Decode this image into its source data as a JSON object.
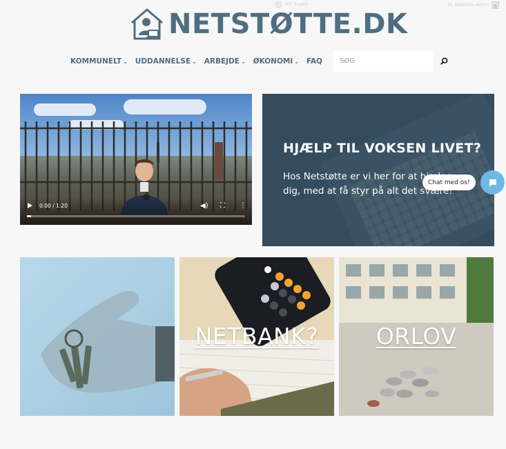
{
  "topbar": {
    "toggle_label": "HST   Englsh",
    "user_label": "Hi, Netstotte Admin"
  },
  "logo": {
    "text": "NETSTØTTE.DK",
    "icon": "house-person-icon"
  },
  "nav": {
    "items": [
      {
        "label": "KOMMUNELT",
        "has_dropdown": true
      },
      {
        "label": "UDDANNELSE",
        "has_dropdown": true
      },
      {
        "label": "ARBEJDE",
        "has_dropdown": true
      },
      {
        "label": "ØKONOMI",
        "has_dropdown": true
      },
      {
        "label": "FAQ",
        "has_dropdown": false
      }
    ],
    "search_placeholder": "SØG",
    "search_icon": "search-icon"
  },
  "video": {
    "time": "0:00 / 1:20",
    "progress": 0.0
  },
  "hero": {
    "title": "HJÆLP TIL VOKSEN LIVET?",
    "text": "Hos Netstøtte er vi her for at hjælpe dig, med at få styr på alt det svære!"
  },
  "chat": {
    "label": "Chat med os!",
    "icon": "chat-icon"
  },
  "cards": [
    {
      "title": ""
    },
    {
      "title": "NETBANK?"
    },
    {
      "title": "ORLOV"
    }
  ],
  "colors": {
    "brand": "#4f6e81",
    "accent": "#6fb8e6",
    "background": "#f7f7f8"
  }
}
